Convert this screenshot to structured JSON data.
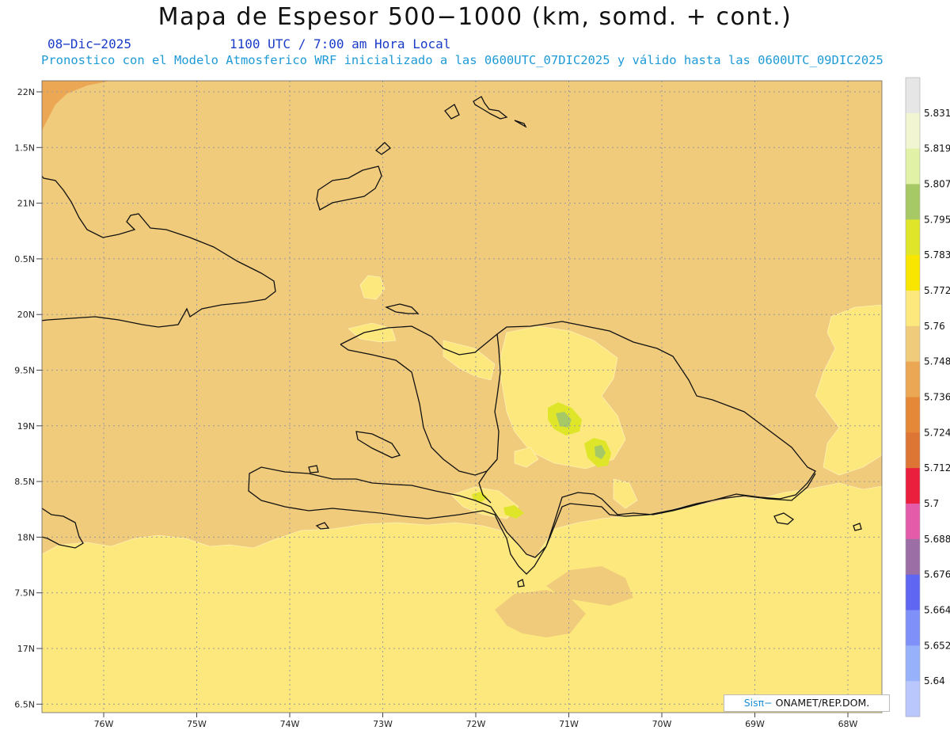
{
  "title": "Mapa de Espesor 500−1000 (km, somd. + cont.)",
  "date": "08−Dic−2025",
  "time": "1100 UTC / 7:00 am Hora Local",
  "subtitle": "Pronostico con el Modelo Atmosferico WRF inicializado a las 0600UTC_07DIC2025 y válido hasta las  0600UTC_09DIC2025",
  "credit": {
    "brand": "Sisπ−",
    "text": " ONAMET/REP.DOM."
  },
  "lat_ticks": [
    "22N",
    "1.5N",
    "21N",
    "0.5N",
    "20N",
    "9.5N",
    "19N",
    "8.5N",
    "18N",
    "7.5N",
    "17N",
    "6.5N"
  ],
  "lon_ticks": [
    "76W",
    "75W",
    "74W",
    "73W",
    "72W",
    "71W",
    "70W",
    "69W",
    "68W"
  ],
  "colorbar": {
    "labels": [
      "5.831",
      "5.819",
      "5.807",
      "5.795",
      "5.783",
      "5.772",
      "5.76",
      "5.748",
      "5.736",
      "5.724",
      "5.712",
      "5.7",
      "5.688",
      "5.676",
      "5.664",
      "5.652",
      "5.64"
    ],
    "colors": [
      "#e6e6e6",
      "#f1f5d2",
      "#e1f2a6",
      "#a7c965",
      "#dfe62a",
      "#f8e600",
      "#fde87e",
      "#f0cb7c",
      "#eca754",
      "#e58838",
      "#dd7535",
      "#ea1f3d",
      "#e35ba9",
      "#9b6ea6",
      "#5f66f2",
      "#7f90f9",
      "#97b1fb",
      "#b9c7fc"
    ]
  },
  "field_colors": {
    "base": "#f0cb7c",
    "higher": "#fde87e",
    "peak": "#dfe62a",
    "core": "#a7c965",
    "lower": "#eca754"
  }
}
